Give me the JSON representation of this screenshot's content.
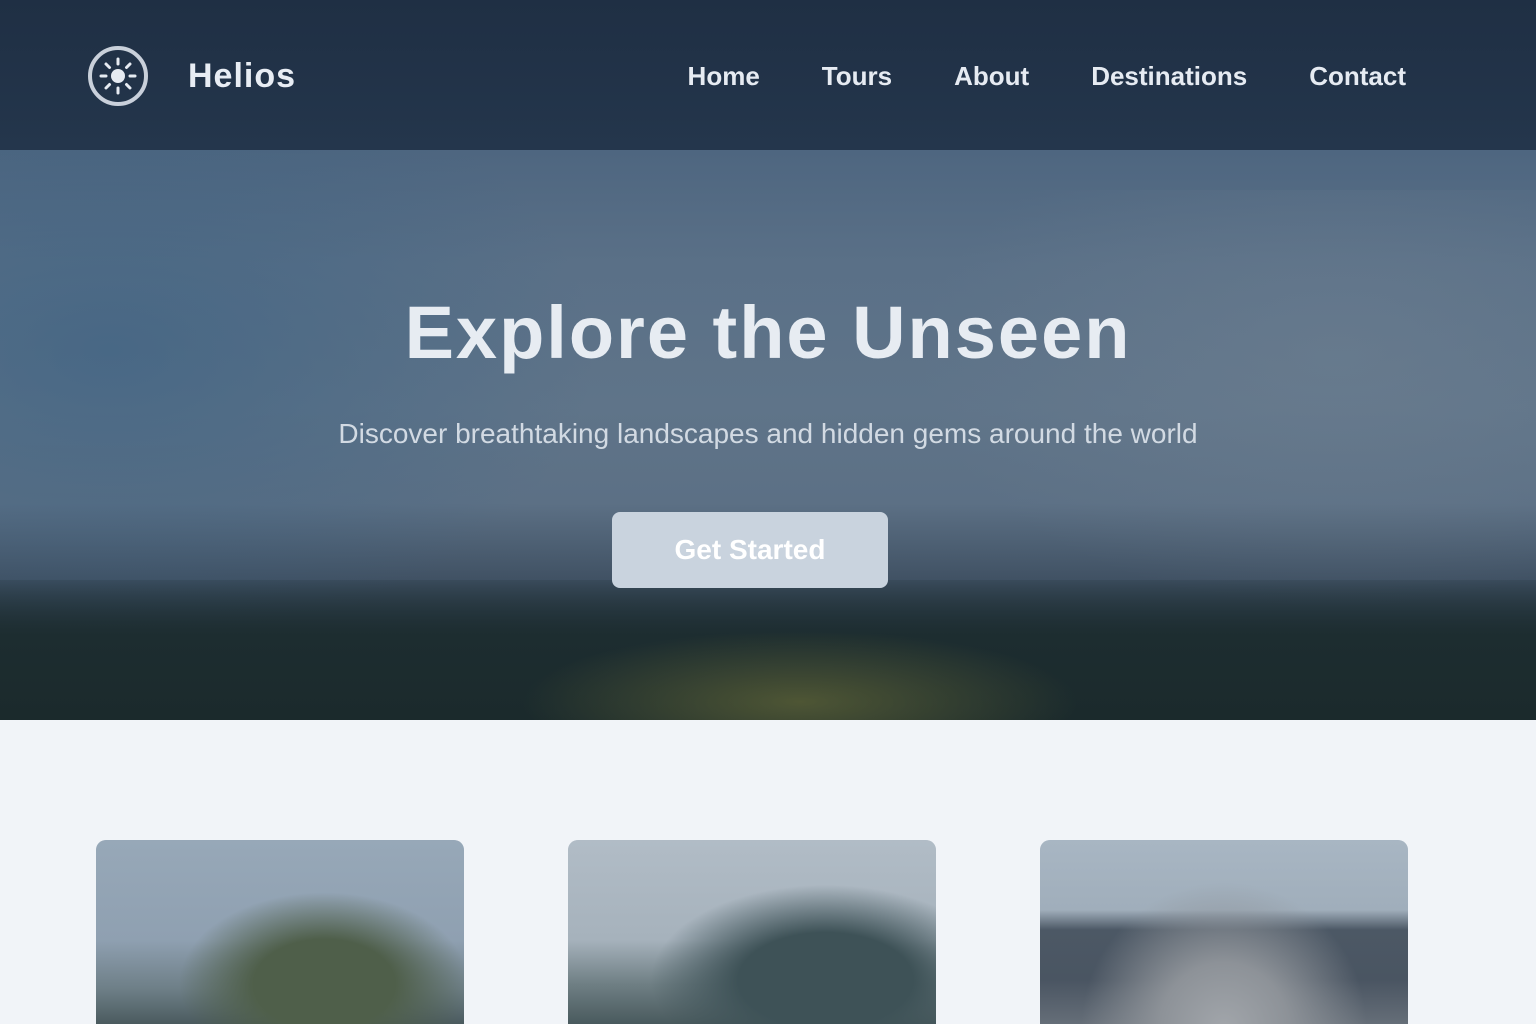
{
  "header": {
    "brand_name": "Helios",
    "logo_icon": "sun-icon",
    "nav": [
      {
        "label": "Home"
      },
      {
        "label": "Tours"
      },
      {
        "label": "About"
      },
      {
        "label": "Destinations"
      },
      {
        "label": "Contact"
      }
    ]
  },
  "hero": {
    "title": "Explore the Unseen",
    "subtitle": "Discover breathtaking landscapes and hidden gems around the world",
    "cta_label": "Get Started"
  },
  "cards": [
    {
      "image": "forest-landscape-image"
    },
    {
      "image": "hills-landscape-image"
    },
    {
      "image": "coastal-landscape-image"
    }
  ],
  "colors": {
    "header_bg": "#1f2f44",
    "hero_sky": "#5f7489",
    "page_bg": "#f1f4f8",
    "cta_bg": "#c9d3de"
  }
}
